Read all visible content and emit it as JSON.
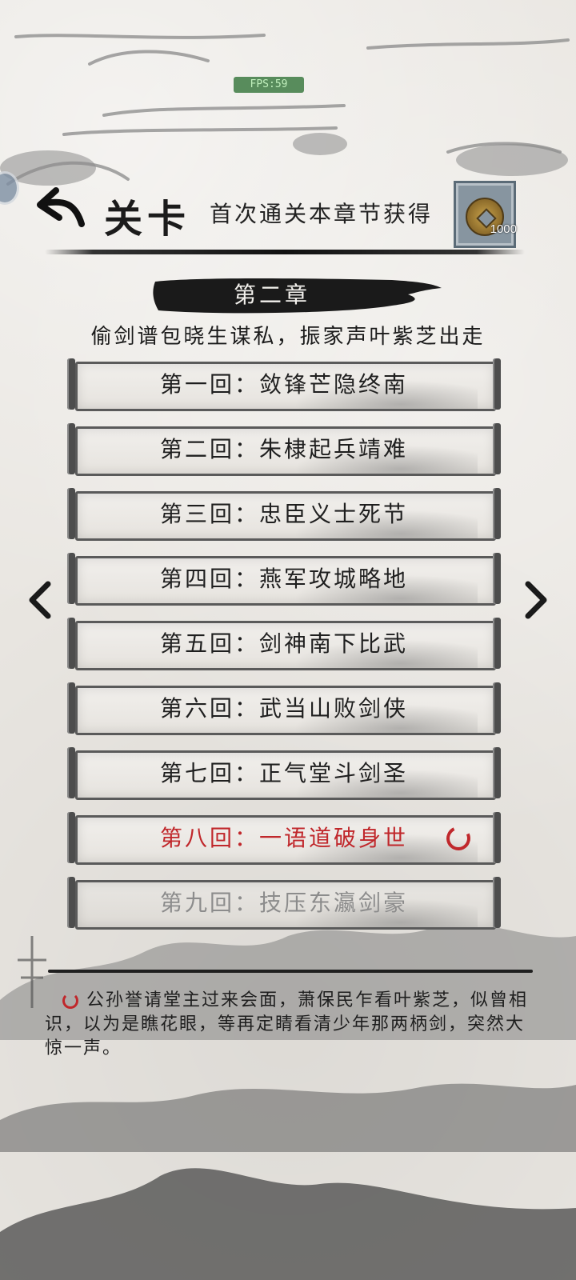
{
  "debug": {
    "fps": "FPS:59"
  },
  "header": {
    "title": "关卡",
    "reward_text": "首次通关本章节获得",
    "reward_icon": "copper-coin-icon",
    "reward_amount": "1000"
  },
  "chapter": {
    "label": "第二章",
    "subtitle": "偷剑谱包晓生谋私，振家声叶紫芝出走"
  },
  "episodes": [
    {
      "title": "第一回：敛锋芒隐终南",
      "state": "cleared"
    },
    {
      "title": "第二回：朱棣起兵靖难",
      "state": "cleared"
    },
    {
      "title": "第三回：忠臣义士死节",
      "state": "cleared"
    },
    {
      "title": "第四回：燕军攻城略地",
      "state": "cleared"
    },
    {
      "title": "第五回：剑神南下比武",
      "state": "cleared"
    },
    {
      "title": "第六回：武当山败剑侠",
      "state": "cleared"
    },
    {
      "title": "第七回：正气堂斗剑圣",
      "state": "cleared"
    },
    {
      "title": "第八回：一语道破身世",
      "state": "current"
    },
    {
      "title": "第九回：技压东瀛剑豪",
      "state": "locked"
    }
  ],
  "description": "公孙誉请堂主过来会面，萧保民乍看叶紫芝，似曾相识，以为是瞧花眼，等再定睛看清少年那两柄剑，突然大惊一声。",
  "colors": {
    "current": "#c0272b",
    "locked": "#8c8c8c",
    "ink": "#1b1b1b"
  }
}
